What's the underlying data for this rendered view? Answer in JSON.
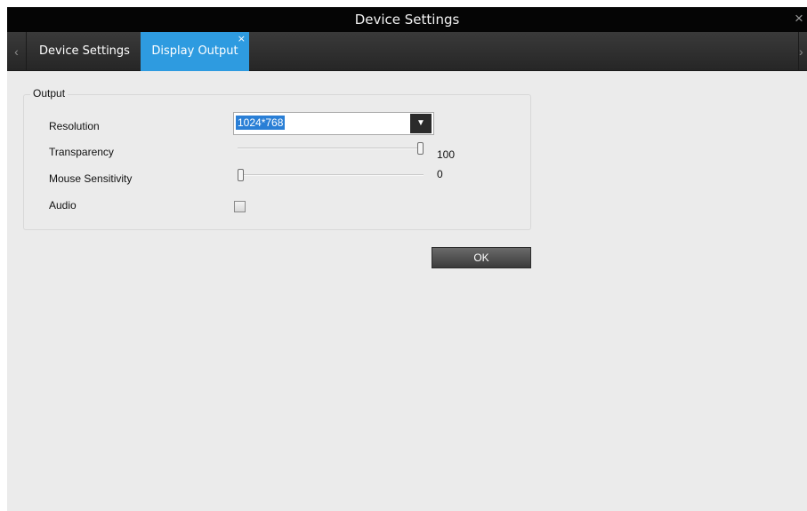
{
  "window": {
    "title": "Device Settings",
    "close_glyph": "×"
  },
  "tabs": {
    "prev_glyph": "‹",
    "next_glyph": "›",
    "items": [
      {
        "label": "Device Settings",
        "active": false
      },
      {
        "label": "Display Output",
        "active": true,
        "close_glyph": "×"
      }
    ],
    "active_color": "#2e9be0"
  },
  "output": {
    "group_label": "Output",
    "resolution": {
      "label": "Resolution",
      "value": "1024*768",
      "dropdown_glyph": "▼"
    },
    "transparency": {
      "label": "Transparency",
      "value": "100",
      "fraction": 1.0
    },
    "mouse_sensitivity": {
      "label": "Mouse Sensitivity",
      "value": "0",
      "fraction": 0.0
    },
    "audio": {
      "label": "Audio",
      "checked": false
    }
  },
  "actions": {
    "ok_label": "OK"
  }
}
